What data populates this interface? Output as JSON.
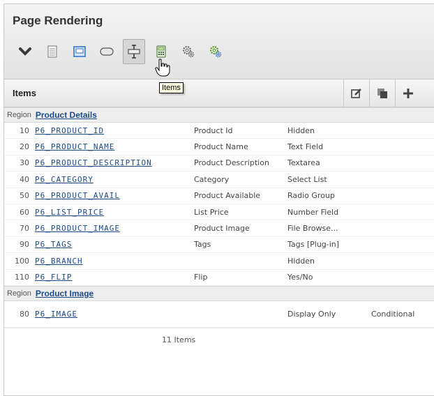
{
  "page_rendering": {
    "title": "Page Rendering",
    "toolbar_icons": [
      "chevron-down-icon",
      "document-icon",
      "region-icon",
      "button-icon",
      "item-icon",
      "calculator-icon",
      "gear-process-icon",
      "gear-green-icon"
    ]
  },
  "items": {
    "title": "Items",
    "tooltip": "Items"
  },
  "regions": [
    {
      "label": "Region",
      "name": "Product Details",
      "rows": [
        {
          "seq": "10",
          "name": "P6_PRODUCT_ID",
          "label": "Product Id",
          "type": "Hidden",
          "cond": ""
        },
        {
          "seq": "20",
          "name": "P6_PRODUCT_NAME",
          "label": "Product Name",
          "type": "Text Field",
          "cond": ""
        },
        {
          "seq": "30",
          "name": "P6_PRODUCT_DESCRIPTION",
          "label": "Product Description",
          "type": "Textarea",
          "cond": ""
        },
        {
          "seq": "40",
          "name": "P6_CATEGORY",
          "label": "Category",
          "type": "Select List",
          "cond": ""
        },
        {
          "seq": "50",
          "name": "P6_PRODUCT_AVAIL",
          "label": "Product Available",
          "type": "Radio Group",
          "cond": ""
        },
        {
          "seq": "60",
          "name": "P6_LIST_PRICE",
          "label": "List Price",
          "type": "Number Field",
          "cond": ""
        },
        {
          "seq": "70",
          "name": "P6_PRODUCT_IMAGE",
          "label": "Product Image",
          "type": "File Browse...",
          "cond": ""
        },
        {
          "seq": "90",
          "name": "P6_TAGS",
          "label": "Tags",
          "type": "Tags [Plug-in]",
          "cond": ""
        },
        {
          "seq": "100",
          "name": "P6_BRANCH",
          "label": "",
          "type": "Hidden",
          "cond": ""
        },
        {
          "seq": "110",
          "name": "P6_FLIP",
          "label": "Flip",
          "type": "Yes/No",
          "cond": ""
        }
      ]
    },
    {
      "label": "Region",
      "name": "Product Image",
      "rows": [
        {
          "seq": "80",
          "name": "P6_IMAGE",
          "label": "",
          "type": "Display Only",
          "cond": "Conditional"
        }
      ]
    }
  ],
  "footer": {
    "count_text": "11 Items"
  },
  "colors": {
    "link": "#1c4a86",
    "header_bg": "#e8e8e8",
    "region_bg": "#eeeeee",
    "tooltip_bg": "#ffffe1"
  }
}
